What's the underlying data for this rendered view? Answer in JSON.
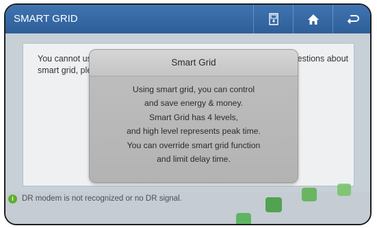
{
  "header": {
    "title": "SMART GRID"
  },
  "toolbar": {
    "buttons": [
      {
        "icon": "energy-meter-icon"
      },
      {
        "icon": "home-icon"
      },
      {
        "icon": "back-icon"
      }
    ]
  },
  "background_message": {
    "line1_left": "You cannot us",
    "line1_right": "estions about",
    "line2_left": "smart grid, ple"
  },
  "dialog": {
    "title": "Smart Grid",
    "lines": [
      "Using smart grid, you can control",
      "and save energy & money.",
      "Smart Grid has 4 levels,",
      "and high level represents peak time.",
      "You can override smart grid function",
      "and limit delay time."
    ]
  },
  "status": {
    "icon": "info-icon",
    "text": "DR modem is not recognized or no DR signal."
  },
  "colors": {
    "titlebar": "#3a6ca8",
    "status_icon": "#5fae2a",
    "decor_green": "#4caf50"
  }
}
